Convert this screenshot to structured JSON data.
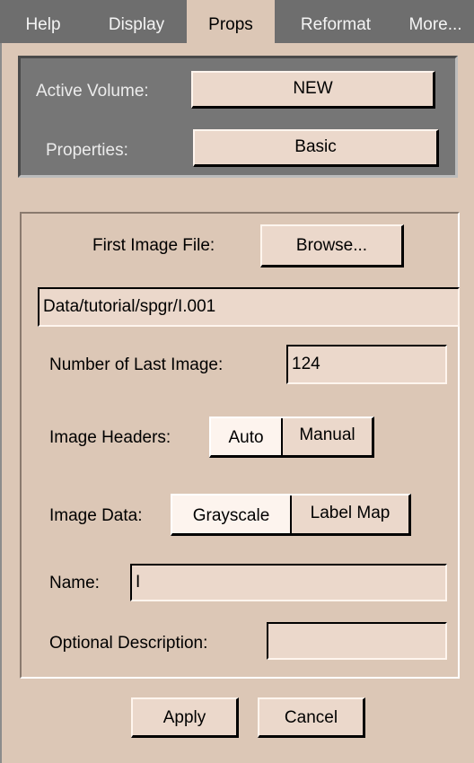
{
  "tabs": [
    {
      "label": "Help"
    },
    {
      "label": "Display"
    },
    {
      "label": "Props"
    },
    {
      "label": "Reformat"
    },
    {
      "label": "More..."
    }
  ],
  "active_tab": "Props",
  "volume": {
    "active_volume_label": "Active Volume:",
    "active_volume_value": "NEW",
    "properties_label": "Properties:",
    "properties_value": "Basic"
  },
  "form": {
    "first_image_label": "First Image File:",
    "browse_label": "Browse...",
    "image_path": "Data/tutorial/spgr/I.001",
    "last_image_label": "Number of Last Image:",
    "last_image_value": "124",
    "headers_label": "Image Headers:",
    "headers_options": [
      "Auto",
      "Manual"
    ],
    "headers_selected": "Auto",
    "data_label": "Image Data:",
    "data_options": [
      "Grayscale",
      "Label Map"
    ],
    "data_selected": "Grayscale",
    "name_label": "Name:",
    "name_value": "I",
    "description_label": "Optional Description:",
    "description_value": ""
  },
  "actions": {
    "apply_label": "Apply",
    "cancel_label": "Cancel"
  },
  "colors": {
    "tabbar": "#6e6e6e",
    "background": "#dcc7b6",
    "panel": "#767676",
    "button": "#ebd8cb"
  }
}
